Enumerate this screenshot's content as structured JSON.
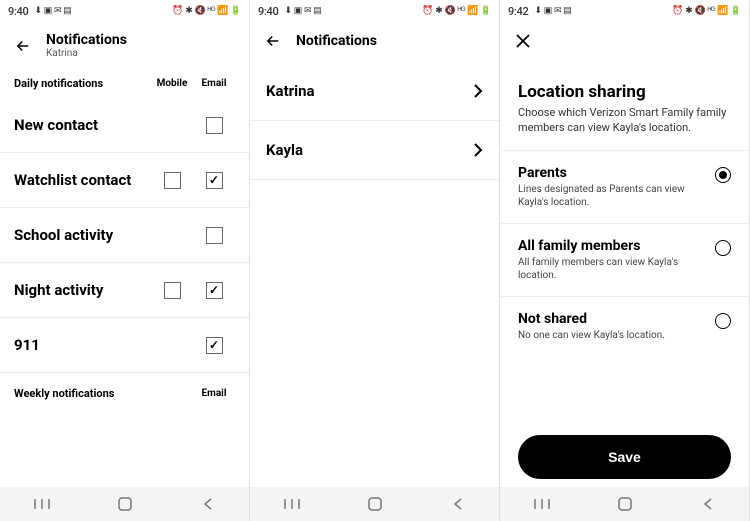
{
  "status": {
    "time1": "9:40",
    "time2": "9:40",
    "time3": "9:42"
  },
  "s1": {
    "title": "Notifications",
    "subtitle": "Katrina",
    "section": "Daily notifications",
    "col_mobile": "Mobile",
    "col_email": "Email",
    "rows": [
      {
        "label": "New contact"
      },
      {
        "label": "Watchlist contact"
      },
      {
        "label": "School activity"
      },
      {
        "label": "Night activity"
      },
      {
        "label": "911"
      }
    ],
    "weekly_label": "Weekly notifications",
    "weekly_col": "Email"
  },
  "s2": {
    "title": "Notifications",
    "people": [
      {
        "name": "Katrina"
      },
      {
        "name": "Kayla"
      }
    ]
  },
  "s3": {
    "title": "Location sharing",
    "desc": "Choose which Verizon Smart Family family members can view Kayla's location.",
    "options": [
      {
        "title": "Parents",
        "desc": "Lines designated as Parents can view Kayla's location.",
        "selected": true
      },
      {
        "title": "All family members",
        "desc": "All family members can view Kayla's location.",
        "selected": false
      },
      {
        "title": "Not shared",
        "desc": "No one can view Kayla's location.",
        "selected": false
      }
    ],
    "save": "Save"
  }
}
